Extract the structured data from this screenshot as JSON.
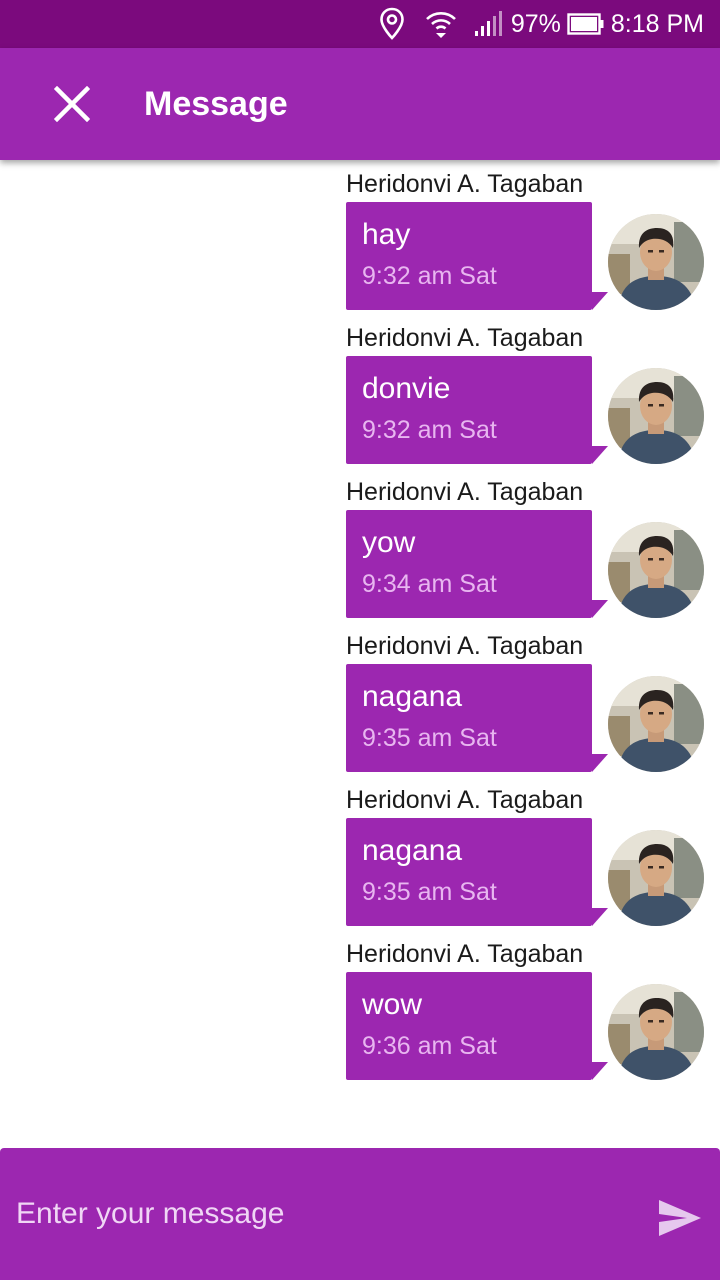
{
  "status_bar": {
    "battery": "97%",
    "time": "8:18 PM",
    "icons": [
      "location-icon",
      "wifi-icon",
      "signal-icon",
      "battery-icon"
    ]
  },
  "app_bar": {
    "title": "Message",
    "close_icon": "close-icon"
  },
  "messages": [
    {
      "sender": "Heridonvi A. Tagaban",
      "text": "hay",
      "time": "9:32 am Sat"
    },
    {
      "sender": "Heridonvi A. Tagaban",
      "text": "donvie",
      "time": "9:32 am Sat"
    },
    {
      "sender": "Heridonvi A. Tagaban",
      "text": "yow",
      "time": "9:34 am Sat"
    },
    {
      "sender": "Heridonvi A. Tagaban",
      "text": "nagana",
      "time": "9:35 am Sat"
    },
    {
      "sender": "Heridonvi A. Tagaban",
      "text": "nagana",
      "time": "9:35 am Sat"
    },
    {
      "sender": "Heridonvi A. Tagaban",
      "text": "wow",
      "time": "9:36 am Sat"
    }
  ],
  "composer": {
    "placeholder": "Enter your message",
    "value": "",
    "send_icon": "send-icon"
  },
  "colors": {
    "status_bar": "#7b0a7d",
    "primary": "#9c27b0",
    "timestamp": "#e8b6f0"
  }
}
